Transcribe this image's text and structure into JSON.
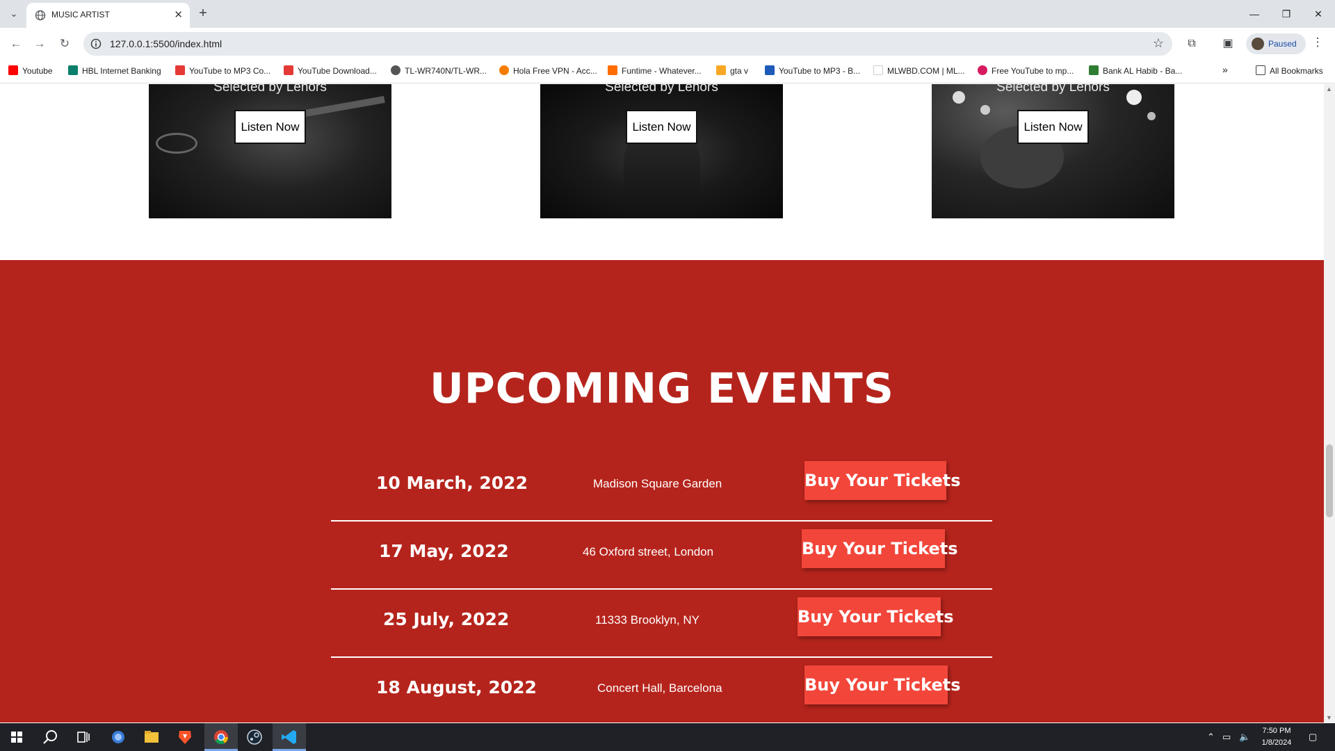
{
  "browser": {
    "tab_title": "MUSIC ARTIST",
    "url": "127.0.0.1:5500/index.html",
    "profile_status": "Paused",
    "all_bookmarks": "All Bookmarks",
    "bookmarks": [
      {
        "label": "Youtube",
        "color": "#ff0000"
      },
      {
        "label": "HBL Internet Banking",
        "color": "#0a7f6b"
      },
      {
        "label": "YouTube to MP3 Co...",
        "color": "#e53935"
      },
      {
        "label": "YouTube Download...",
        "color": "#e53935"
      },
      {
        "label": "TL-WR740N/TL-WR...",
        "color": "#555555"
      },
      {
        "label": "Hola Free VPN - Acc...",
        "color": "#f57c00"
      },
      {
        "label": "Funtime - Whatever...",
        "color": "#ff6d00"
      },
      {
        "label": "gta v",
        "color": "#f9a825"
      },
      {
        "label": "YouTube to MP3 - B...",
        "color": "#1e5bb8"
      },
      {
        "label": "MLWBD.COM | ML...",
        "color": "#ffffff"
      },
      {
        "label": "Free YouTube to mp...",
        "color": "#d81b60"
      },
      {
        "label": "Bank AL Habib - Ba...",
        "color": "#2e7d32"
      }
    ]
  },
  "songs": [
    {
      "caption": "Selected by Lenors",
      "button": "Listen Now"
    },
    {
      "caption": "Selected by Lenors",
      "button": "Listen Now"
    },
    {
      "caption": "Selected by Lenors",
      "button": "Listen Now"
    }
  ],
  "events": {
    "title": "UPCOMING EVENTS",
    "accent": "#b5241c",
    "button_color": "#f2463a",
    "rows": [
      {
        "date": "10 March, 2022",
        "venue": "Madison Square Garden",
        "button": "Buy Your Tickets"
      },
      {
        "date": "17 May, 2022",
        "venue": "46 Oxford street, London",
        "button": "Buy Your Tickets"
      },
      {
        "date": "25 July, 2022",
        "venue": "11333 Brooklyn, NY",
        "button": "Buy Your Tickets"
      },
      {
        "date": "18 August, 2022",
        "venue": "Concert Hall, Barcelona",
        "button": "Buy Your Tickets"
      }
    ]
  },
  "taskbar": {
    "time": "7:50 PM",
    "date": "1/8/2024"
  }
}
